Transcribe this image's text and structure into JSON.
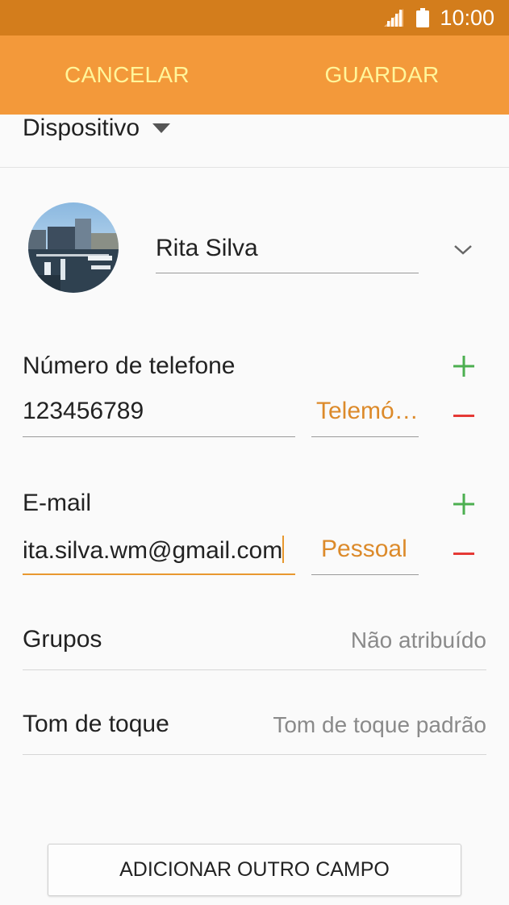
{
  "status_bar": {
    "time": "10:00",
    "signal_icon": "signal-icon",
    "battery_icon": "battery-icon"
  },
  "action_bar": {
    "cancel_label": "CANCELAR",
    "save_label": "GUARDAR"
  },
  "storage": {
    "label": "Dispositivo",
    "icon": "dropdown-triangle-icon"
  },
  "contact": {
    "name": "Rita Silva",
    "expand_icon": "chevron-down-icon"
  },
  "phone": {
    "label": "Número de telefone",
    "value": "123456789",
    "type": "Telemó…"
  },
  "email": {
    "label": "E-mail",
    "value": "ita.silva.wm@gmail.com",
    "type": "Pessoal"
  },
  "groups": {
    "label": "Grupos",
    "value": "Não atribuído"
  },
  "ringtone": {
    "label": "Tom de toque",
    "value": "Tom de toque padrão"
  },
  "add_field": {
    "label": "ADICIONAR OUTRO CAMPO"
  },
  "colors": {
    "status_bar": "#d37d1c",
    "action_bar": "#f3993a",
    "action_text": "#fff59a",
    "accent": "#e8982f",
    "plus": "#4caf50",
    "minus": "#e53935"
  }
}
